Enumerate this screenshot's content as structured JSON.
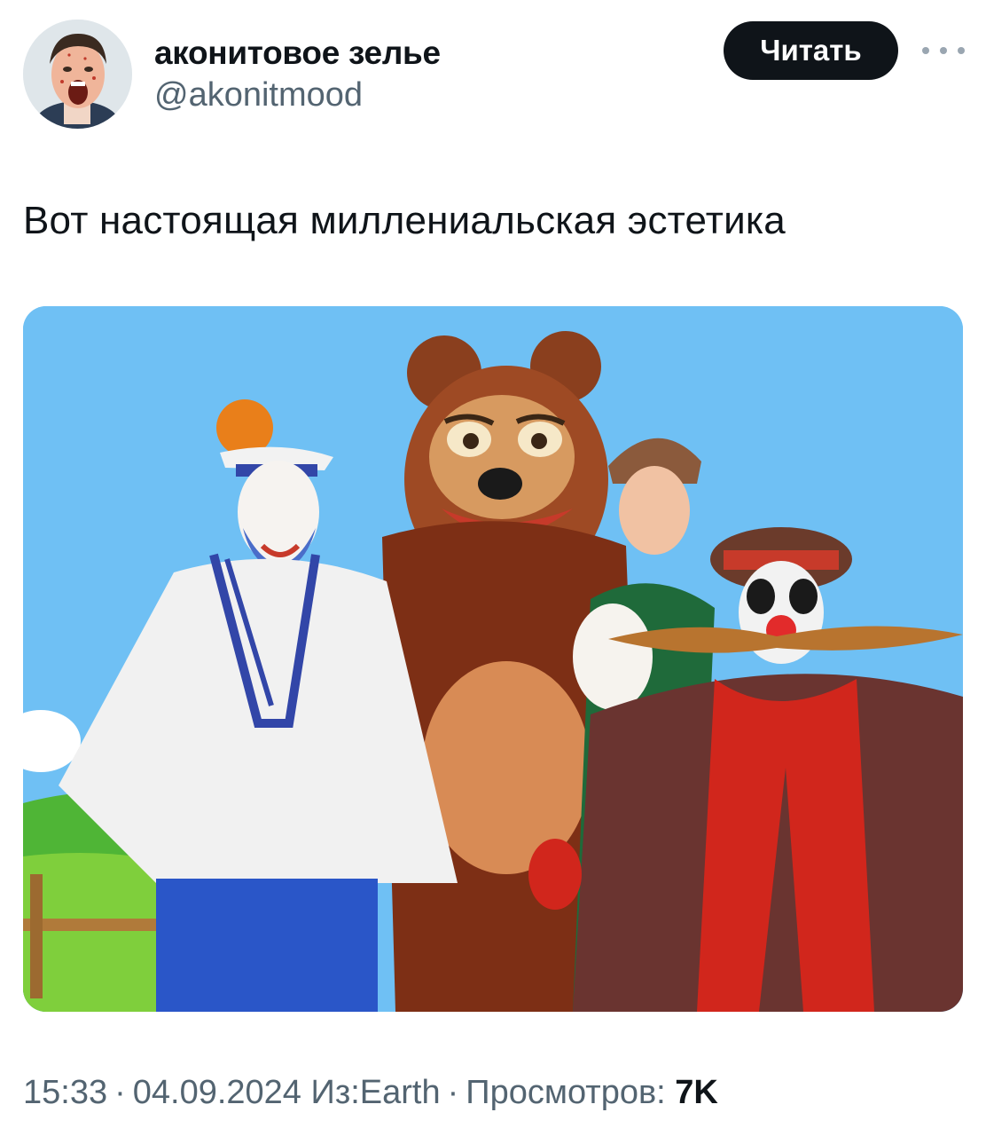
{
  "author": {
    "display_name": "аконитовое зелье",
    "handle": "@akonitmood",
    "avatar_icon": "avatar-photo"
  },
  "actions": {
    "follow_label": "Читать",
    "more_icon": "more-dots-icon"
  },
  "tweet": {
    "text": "Вот настоящая миллениальская эстетика",
    "media_icon": "photo-attachment"
  },
  "meta": {
    "time": "15:33",
    "separator": "·",
    "date": "04.09.2024",
    "source": "Из:Earth",
    "views_label": "Просмотров:",
    "views_count": "7K"
  },
  "colors": {
    "follow_bg": "#0f1419",
    "secondary_text": "#536471",
    "sky": "#6fc0f4"
  }
}
